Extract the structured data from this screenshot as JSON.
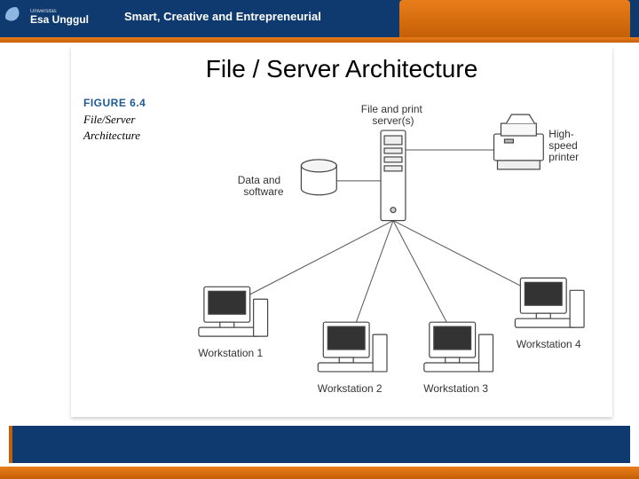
{
  "header": {
    "university_prefix": "Universitas",
    "university_name": "Esa Unggul",
    "tagline": "Smart, Creative and Entrepreneurial"
  },
  "slide": {
    "title": "File / Server Architecture"
  },
  "figure": {
    "number": "FIGURE 6.4",
    "name_line1": "File/Server",
    "name_line2": "Architecture",
    "labels": {
      "server": "File and print\nserver(s)",
      "data": "Data and\nsoftware",
      "printer": "High-\nspeed\nprinter",
      "ws1": "Workstation 1",
      "ws2": "Workstation 2",
      "ws3": "Workstation 3",
      "ws4": "Workstation 4"
    }
  }
}
